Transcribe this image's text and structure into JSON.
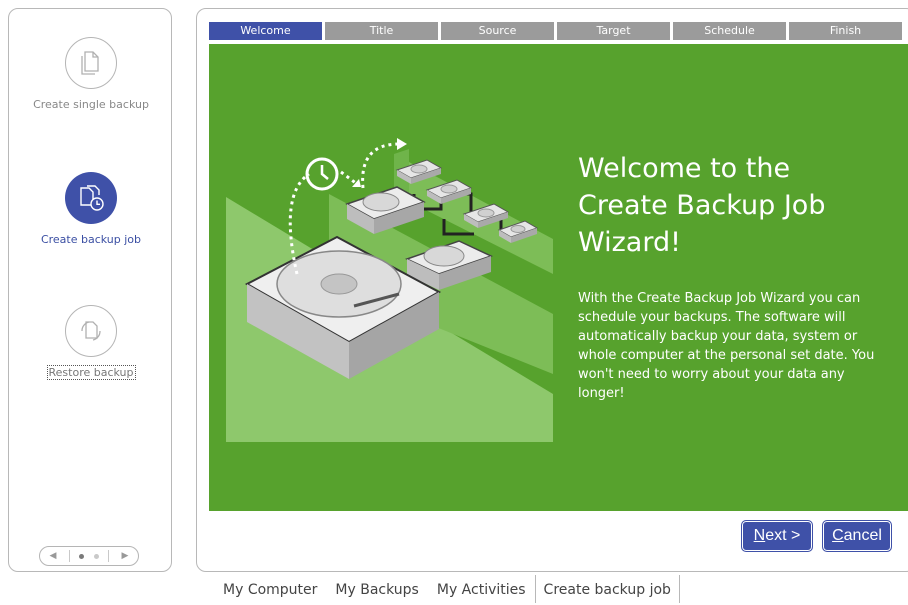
{
  "sidebar": {
    "items": [
      {
        "label": "Create single backup",
        "icon": "single-file-icon"
      },
      {
        "label": "Create backup job",
        "icon": "backup-job-icon"
      },
      {
        "label": "Restore backup",
        "icon": "restore-icon"
      }
    ],
    "pager": {
      "prev_icon": "chevron-left-icon",
      "next_icon": "chevron-right-icon",
      "pages": 2,
      "current": 1
    }
  },
  "wizard": {
    "steps": [
      "Welcome",
      "Title",
      "Source",
      "Target",
      "Schedule",
      "Finish"
    ],
    "active_step": "Welcome",
    "title": "Welcome to the Create Backup Job Wizard!",
    "description": "With the Create Backup Job Wizard you can schedule your backups. The software will automatically backup your data, system or whole computer at the personal set date. You won't need to worry about your data any longer!",
    "next_label": "Next >",
    "next_mnemonic": "N",
    "next_rest": "ext >",
    "cancel_label": "Cancel",
    "cancel_mnemonic": "C",
    "cancel_rest": "ancel"
  },
  "bottom_tabs": [
    "My Computer",
    "My Backups",
    "My Activities",
    "Create backup job"
  ],
  "active_tab": "Create backup job",
  "colors": {
    "accent": "#3f51a8",
    "panel_green": "#57a22d",
    "step_inactive": "#9b9b9b"
  }
}
